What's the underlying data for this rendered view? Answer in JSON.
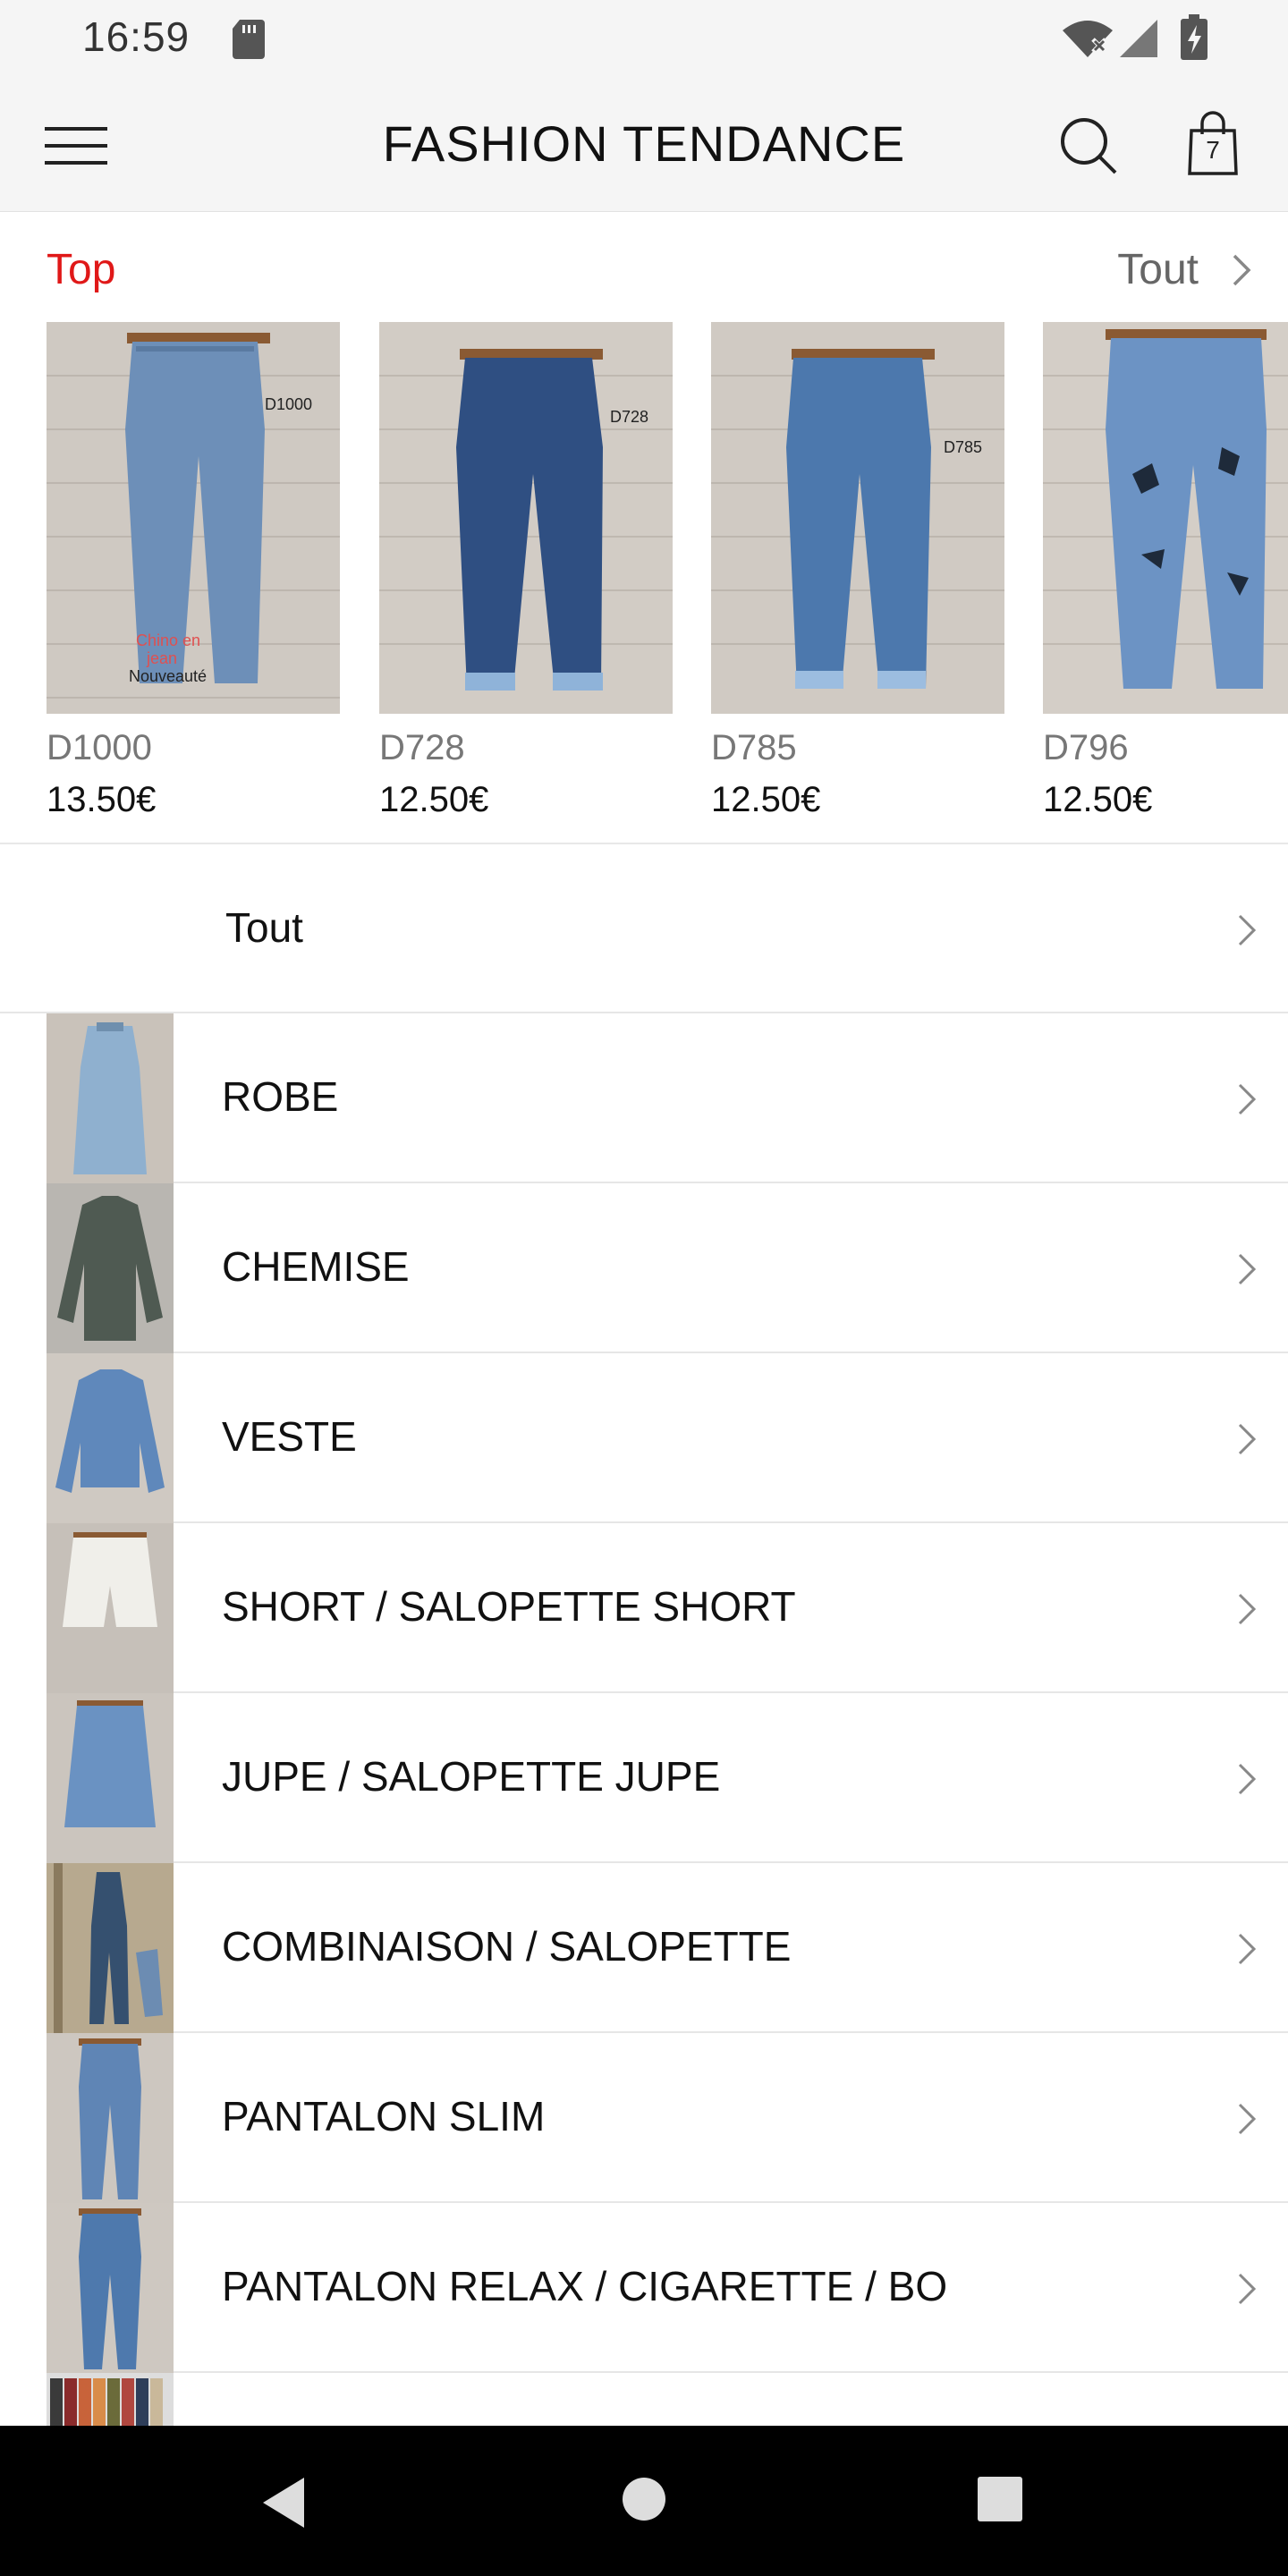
{
  "status_bar": {
    "time": "16:59",
    "icons": [
      "sd-card-icon",
      "wifi-icon",
      "signal-icon",
      "battery-charging-icon"
    ]
  },
  "app_bar": {
    "title": "FASHION TENDANCE",
    "cart_count": "7",
    "icons": [
      "menu-icon",
      "search-icon",
      "shopping-bag-icon"
    ]
  },
  "top_section": {
    "label": "Top",
    "see_all": "Tout",
    "products": [
      {
        "name": "D1000",
        "price": "13.50€"
      },
      {
        "name": "D728",
        "price": "12.50€"
      },
      {
        "name": "D785",
        "price": "12.50€"
      },
      {
        "name": "D796",
        "price": "12.50€"
      }
    ]
  },
  "categories": {
    "all_label": "Tout",
    "items": [
      {
        "label": "ROBE"
      },
      {
        "label": "CHEMISE"
      },
      {
        "label": "VESTE"
      },
      {
        "label": "SHORT / SALOPETTE SHORT"
      },
      {
        "label": "JUPE / SALOPETTE JUPE"
      },
      {
        "label": "COMBINAISON / SALOPETTE"
      },
      {
        "label": "PANTALON SLIM"
      },
      {
        "label": "PANTALON RELAX / CIGARETTE / BO"
      }
    ]
  },
  "colors": {
    "accent_red": "#e01818",
    "bar_bg": "#f5f5f5",
    "nav_bg": "#000000"
  }
}
